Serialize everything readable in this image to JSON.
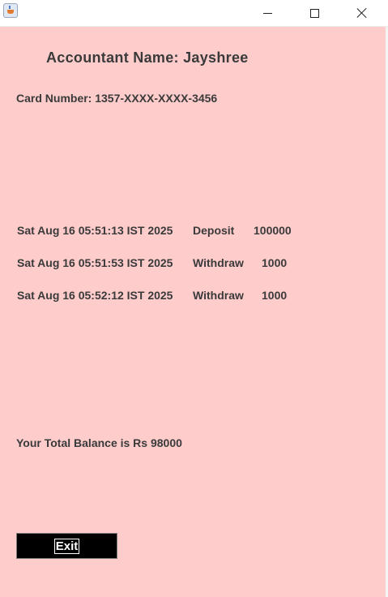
{
  "window": {
    "icon": "java-cup-icon"
  },
  "account": {
    "accountant_name": "Accountant Name: Jayshree",
    "card_number": "Card Number: 1357-XXXX-XXXX-3456"
  },
  "transactions": [
    {
      "date": "Sat Aug 16 05:51:13 IST 2025",
      "type": "Deposit",
      "amount": "100000"
    },
    {
      "date": "Sat Aug 16 05:51:53 IST 2025",
      "type": "Withdraw",
      "amount": "1000"
    },
    {
      "date": "Sat Aug 16 05:52:12 IST 2025",
      "type": "Withdraw",
      "amount": "1000"
    }
  ],
  "balance_text": "Your Total Balance is Rs 98000",
  "exit_label": "Exit",
  "colors": {
    "background": "#ffcccc",
    "text": "#3a3a3a",
    "button": "#000000",
    "button_text": "#ffffff"
  }
}
